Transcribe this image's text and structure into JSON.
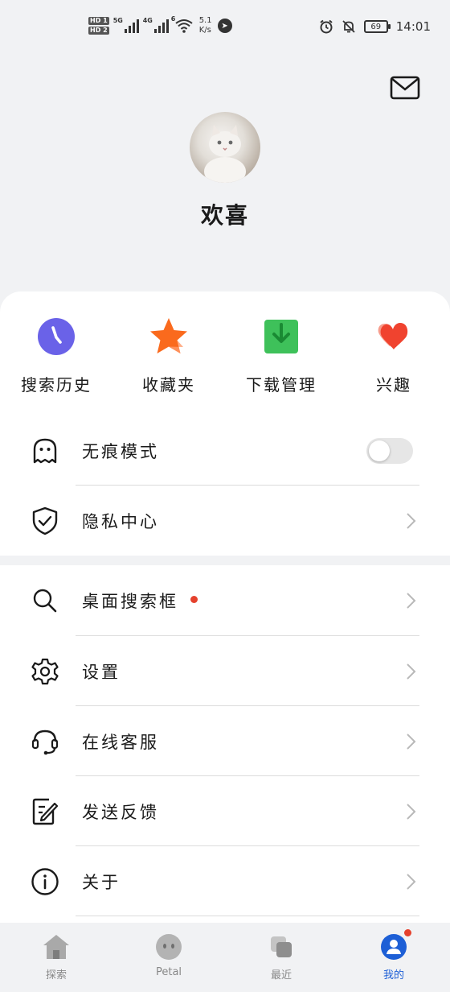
{
  "status_bar": {
    "hd1": "HD 1",
    "hd2": "HD 2",
    "sig1_type": "5G",
    "sig2_type": "4G",
    "wifi_type": "6",
    "net_speed_value": "5.1",
    "net_speed_unit": "K/s",
    "battery": "69",
    "time": "14:01"
  },
  "profile": {
    "username": "欢喜"
  },
  "quick_actions": [
    {
      "label": "搜索历史",
      "icon": "clock-icon",
      "color": "#6a62e8"
    },
    {
      "label": "收藏夹",
      "icon": "star-icon",
      "color": "#fa6a1d"
    },
    {
      "label": "下载管理",
      "icon": "download-icon",
      "color": "#3ec15a"
    },
    {
      "label": "兴趣",
      "icon": "heart-icon",
      "color": "#f0432f"
    }
  ],
  "menu": {
    "incognito": {
      "label": "无痕模式",
      "enabled": false
    },
    "privacy": {
      "label": "隐私中心"
    },
    "desktop_search": {
      "label": "桌面搜索框"
    },
    "settings": {
      "label": "设置"
    },
    "support": {
      "label": "在线客服"
    },
    "feedback": {
      "label": "发送反馈"
    },
    "about": {
      "label": "关于"
    }
  },
  "tabs": [
    {
      "label": "探索",
      "icon": "home-icon"
    },
    {
      "label": "Petal",
      "icon": "petal-face-icon"
    },
    {
      "label": "最近",
      "icon": "recent-cards-icon"
    },
    {
      "label": "我的",
      "icon": "user-icon",
      "active": true
    }
  ],
  "colors": {
    "accent": "#1d5fd6",
    "badge": "#e5412d"
  }
}
